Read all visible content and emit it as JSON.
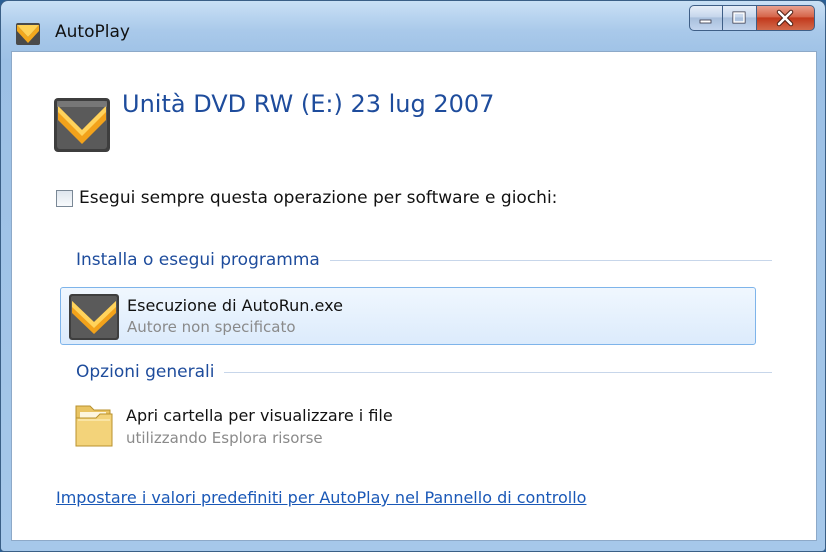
{
  "window": {
    "title": "AutoPlay",
    "icon": "autoplay-icon",
    "caption_buttons": [
      "minimize-icon",
      "maximize-icon",
      "close-icon"
    ]
  },
  "header": {
    "drive_title": "Unità DVD RW (E:) 23 lug 2007",
    "drive_icon": "autorun-drive-icon"
  },
  "always_option": {
    "label": "Esegui sempre questa operazione per software e giochi:",
    "checked": false
  },
  "sections": [
    {
      "heading": "Installa o esegui programma",
      "items": [
        {
          "title": "Esecuzione di AutoRun.exe",
          "subtitle": "Autore non specificato",
          "icon": "autorun-app-icon",
          "selected": true
        }
      ]
    },
    {
      "heading": "Opzioni generali",
      "items": [
        {
          "title": "Apri cartella per visualizzare i file",
          "subtitle": "utilizzando Esplora risorse",
          "icon": "folder-icon",
          "selected": false
        }
      ]
    }
  ],
  "footer": {
    "link": "Impostare i valori predefiniti per AutoPlay nel Pannello di controllo"
  },
  "colors": {
    "heading": "#1e4c9c",
    "link": "#1a58b7",
    "selection": "#dcebfc",
    "frame": "#a9c9ea"
  }
}
